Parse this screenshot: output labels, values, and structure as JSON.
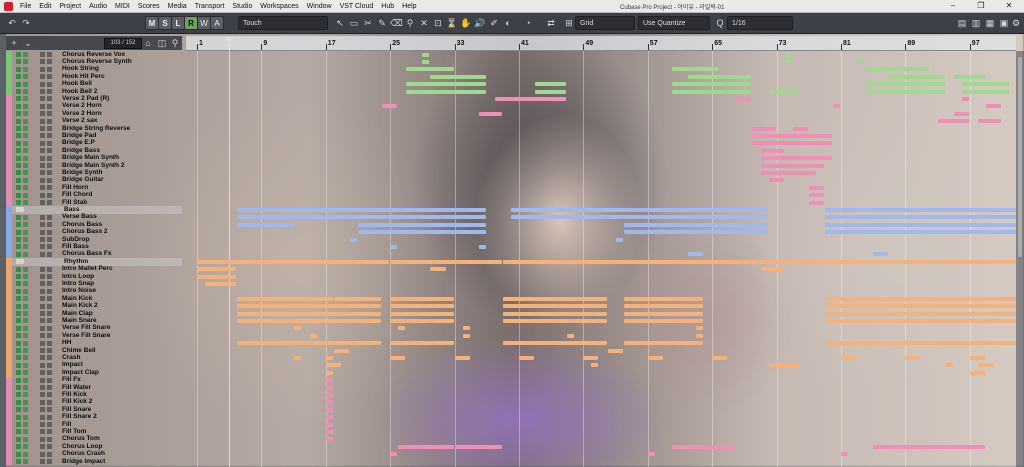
{
  "window": {
    "title": "Cubase Pro Project - 아이유 - 라일락-01"
  },
  "menubar": {
    "items": [
      "File",
      "Edit",
      "Project",
      "Audio",
      "MIDI",
      "Scores",
      "Media",
      "Transport",
      "Studio",
      "Workspaces",
      "Window",
      "VST Cloud",
      "Hub",
      "Help"
    ]
  },
  "toolbar": {
    "m": "M",
    "s": "S",
    "l": "L",
    "r": "R",
    "w": "W",
    "a": "A",
    "automation_mode": "Touch",
    "snap_type": "Grid",
    "quantize_mode": "Use Quantize",
    "quantize_value": "1/16"
  },
  "tracklist": {
    "counter": "103 / 152"
  },
  "ruler": {
    "bars": [
      "1",
      "9",
      "17",
      "25",
      "33",
      "41",
      "49",
      "57",
      "65",
      "73",
      "81",
      "89",
      "97"
    ]
  },
  "tracks": [
    {
      "name": "Chorus Reverse Vox",
      "color": "#7cc47a"
    },
    {
      "name": "Chorus Reverse Synth",
      "color": "#7cc47a"
    },
    {
      "name": "Hook String",
      "color": "#7cc47a"
    },
    {
      "name": "Hook Hit Perc",
      "color": "#7cc47a"
    },
    {
      "name": "Hook Bell",
      "color": "#7cc47a"
    },
    {
      "name": "Hook Bell 2",
      "color": "#7cc47a"
    },
    {
      "name": "Verse 2 Pad (R)",
      "color": "#e58ab0"
    },
    {
      "name": "Verse 2 Horn",
      "color": "#e58ab0"
    },
    {
      "name": "Verse 2 Horn",
      "color": "#e58ab0"
    },
    {
      "name": "Verse 2 sax",
      "color": "#e58ab0"
    },
    {
      "name": "Bridge String Reverse",
      "color": "#e58ab0"
    },
    {
      "name": "Bridge Pad",
      "color": "#e58ab0"
    },
    {
      "name": "Bridge E.P",
      "color": "#e58ab0"
    },
    {
      "name": "Bridge Bass",
      "color": "#e58ab0"
    },
    {
      "name": "Bridge Main Synth",
      "color": "#e58ab0"
    },
    {
      "name": "Bridge Main Synth 2",
      "color": "#e58ab0"
    },
    {
      "name": "Bridge Synth",
      "color": "#e58ab0"
    },
    {
      "name": "Bridge Guitar",
      "color": "#e58ab0"
    },
    {
      "name": "Fill Horn",
      "color": "#e58ab0"
    },
    {
      "name": "Fill Chord",
      "color": "#e58ab0"
    },
    {
      "name": "Fill Stab",
      "color": "#e58ab0"
    },
    {
      "name": "Bass",
      "color": "#8aa8e6",
      "folder": true
    },
    {
      "name": "Verse Bass",
      "color": "#8aa8e6"
    },
    {
      "name": "Chorus Bass",
      "color": "#8aa8e6"
    },
    {
      "name": "Chorus Bass 2",
      "color": "#8aa8e6"
    },
    {
      "name": "SubDrop",
      "color": "#8aa8e6"
    },
    {
      "name": "Fill Bass",
      "color": "#8aa8e6"
    },
    {
      "name": "Chorus Bass Fx",
      "color": "#8aa8e6"
    },
    {
      "name": "Rhythm",
      "color": "#f0a66a",
      "folder": true
    },
    {
      "name": "Intro Mallet Perc",
      "color": "#f0a66a"
    },
    {
      "name": "Intro Loop",
      "color": "#f0a66a"
    },
    {
      "name": "Intro Snap",
      "color": "#f0a66a"
    },
    {
      "name": "Intro Noise",
      "color": "#f0a66a"
    },
    {
      "name": "Main Kick",
      "color": "#f0a66a"
    },
    {
      "name": "Main Kick 2",
      "color": "#f0a66a"
    },
    {
      "name": "Main Clap",
      "color": "#f0a66a"
    },
    {
      "name": "Main Snare",
      "color": "#f0a66a"
    },
    {
      "name": "Verse Fill Snare",
      "color": "#f0a66a"
    },
    {
      "name": "Verse Fill Snare",
      "color": "#f0a66a"
    },
    {
      "name": "HH",
      "color": "#f0a66a"
    },
    {
      "name": "Chime Bell",
      "color": "#f0a66a"
    },
    {
      "name": "Crash",
      "color": "#f0a66a"
    },
    {
      "name": "Impact",
      "color": "#f0a66a"
    },
    {
      "name": "Impact Clap",
      "color": "#f0a66a"
    },
    {
      "name": "Fill Fx",
      "color": "#e58ab0"
    },
    {
      "name": "Fill Water",
      "color": "#e58ab0"
    },
    {
      "name": "Fill Kick",
      "color": "#e58ab0"
    },
    {
      "name": "Fill Kick 2",
      "color": "#e58ab0"
    },
    {
      "name": "Fill Snare",
      "color": "#e58ab0"
    },
    {
      "name": "Fill Snare 2",
      "color": "#e58ab0"
    },
    {
      "name": "Fill",
      "color": "#e58ab0"
    },
    {
      "name": "Fill Tom",
      "color": "#e58ab0"
    },
    {
      "name": "Chorus Tom",
      "color": "#e58ab0"
    },
    {
      "name": "Chorus Loop",
      "color": "#e58ab0"
    },
    {
      "name": "Chorus Crash",
      "color": "#e58ab0"
    },
    {
      "name": "Bridge Impact",
      "color": "#e58ab0"
    }
  ],
  "parts": [
    {
      "row": 0,
      "from": 29,
      "to": 30,
      "color": "#9fd98f"
    },
    {
      "row": 0,
      "from": 74,
      "to": 75,
      "color": "#9fd98f"
    },
    {
      "row": 1,
      "from": 29,
      "to": 30,
      "color": "#9fd98f"
    },
    {
      "row": 1,
      "from": 74,
      "to": 75,
      "color": "#9fd98f"
    },
    {
      "row": 1,
      "from": 83,
      "to": 84,
      "color": "#9fd98f"
    },
    {
      "row": 2,
      "from": 27,
      "to": 33,
      "color": "#9fd98f"
    },
    {
      "row": 2,
      "from": 60,
      "to": 66,
      "color": "#9fd98f"
    },
    {
      "row": 2,
      "from": 84,
      "to": 92,
      "color": "#9fd98f"
    },
    {
      "row": 3,
      "from": 30,
      "to": 37,
      "color": "#9fd98f"
    },
    {
      "row": 3,
      "from": 62,
      "to": 70,
      "color": "#9fd98f"
    },
    {
      "row": 3,
      "from": 87,
      "to": 94,
      "color": "#9fd98f"
    },
    {
      "row": 3,
      "from": 95,
      "to": 99,
      "color": "#9fd98f"
    },
    {
      "row": 4,
      "from": 27,
      "to": 37,
      "color": "#9fd98f"
    },
    {
      "row": 4,
      "from": 43,
      "to": 47,
      "color": "#9fd98f"
    },
    {
      "row": 4,
      "from": 60,
      "to": 70,
      "color": "#9fd98f"
    },
    {
      "row": 4,
      "from": 84,
      "to": 94,
      "color": "#9fd98f"
    },
    {
      "row": 4,
      "from": 96,
      "to": 102,
      "color": "#9fd98f"
    },
    {
      "row": 5,
      "from": 27,
      "to": 37,
      "color": "#9fd98f"
    },
    {
      "row": 5,
      "from": 43,
      "to": 47,
      "color": "#9fd98f"
    },
    {
      "row": 5,
      "from": 60,
      "to": 70,
      "color": "#9fd98f"
    },
    {
      "row": 5,
      "from": 72,
      "to": 76,
      "color": "#9fd98f"
    },
    {
      "row": 5,
      "from": 84,
      "to": 94,
      "color": "#9fd98f"
    },
    {
      "row": 5,
      "from": 96,
      "to": 102,
      "color": "#9fd98f"
    },
    {
      "row": 6,
      "from": 38,
      "to": 47,
      "color": "#ef8fb5"
    },
    {
      "row": 6,
      "from": 68,
      "to": 70,
      "color": "#ef8fb5"
    },
    {
      "row": 6,
      "from": 96,
      "to": 97,
      "color": "#ef8fb5"
    },
    {
      "row": 7,
      "from": 24,
      "to": 26,
      "color": "#ef8fb5"
    },
    {
      "row": 7,
      "from": 80,
      "to": 81,
      "color": "#ef8fb5"
    },
    {
      "row": 7,
      "from": 99,
      "to": 101,
      "color": "#ef8fb5"
    },
    {
      "row": 8,
      "from": 36,
      "to": 39,
      "color": "#ef8fb5"
    },
    {
      "row": 8,
      "from": 95,
      "to": 97,
      "color": "#ef8fb5"
    },
    {
      "row": 9,
      "from": 93,
      "to": 97,
      "color": "#ef8fb5"
    },
    {
      "row": 9,
      "from": 98,
      "to": 101,
      "color": "#ef8fb5"
    },
    {
      "row": 10,
      "from": 70,
      "to": 73,
      "color": "#ef8fb5"
    },
    {
      "row": 10,
      "from": 75,
      "to": 77,
      "color": "#ef8fb5"
    },
    {
      "row": 11,
      "from": 70,
      "to": 80,
      "color": "#ef8fb5"
    },
    {
      "row": 12,
      "from": 70,
      "to": 80,
      "color": "#ef8fb5"
    },
    {
      "row": 13,
      "from": 71,
      "to": 74,
      "color": "#ef8fb5"
    },
    {
      "row": 14,
      "from": 71,
      "to": 80,
      "color": "#ef8fb5"
    },
    {
      "row": 15,
      "from": 71,
      "to": 79,
      "color": "#ef8fb5"
    },
    {
      "row": 16,
      "from": 71,
      "to": 78,
      "color": "#ef8fb5"
    },
    {
      "row": 17,
      "from": 72,
      "to": 74,
      "color": "#ef8fb5"
    },
    {
      "row": 18,
      "from": 77,
      "to": 79,
      "color": "#ef8fb5"
    },
    {
      "row": 19,
      "from": 77,
      "to": 79,
      "color": "#ef8fb5"
    },
    {
      "row": 20,
      "from": 77,
      "to": 79,
      "color": "#ef8fb5"
    },
    {
      "row": 21,
      "from": 6,
      "to": 37,
      "color": "#9fb8ee"
    },
    {
      "row": 21,
      "from": 40,
      "to": 72,
      "color": "#9fb8ee"
    },
    {
      "row": 21,
      "from": 79,
      "to": 103,
      "color": "#9fb8ee"
    },
    {
      "row": 22,
      "from": 6,
      "to": 37,
      "color": "#9fb8ee"
    },
    {
      "row": 22,
      "from": 40,
      "to": 72,
      "color": "#9fb8ee"
    },
    {
      "row": 22,
      "from": 79,
      "to": 103,
      "color": "#9fb8ee"
    },
    {
      "row": 23,
      "from": 6,
      "to": 13,
      "color": "#9fb8ee"
    },
    {
      "row": 23,
      "from": 21,
      "to": 37,
      "color": "#9fb8ee"
    },
    {
      "row": 23,
      "from": 54,
      "to": 72,
      "color": "#9fb8ee"
    },
    {
      "row": 23,
      "from": 79,
      "to": 103,
      "color": "#9fb8ee"
    },
    {
      "row": 24,
      "from": 21,
      "to": 37,
      "color": "#9fb8ee"
    },
    {
      "row": 24,
      "from": 54,
      "to": 72,
      "color": "#9fb8ee"
    },
    {
      "row": 24,
      "from": 79,
      "to": 103,
      "color": "#9fb8ee"
    },
    {
      "row": 25,
      "from": 20,
      "to": 21,
      "color": "#9fb8ee"
    },
    {
      "row": 25,
      "from": 53,
      "to": 54,
      "color": "#9fb8ee"
    },
    {
      "row": 26,
      "from": 25,
      "to": 26,
      "color": "#9fb8ee"
    },
    {
      "row": 26,
      "from": 36,
      "to": 37,
      "color": "#9fb8ee"
    },
    {
      "row": 27,
      "from": 62,
      "to": 64,
      "color": "#9fb8ee"
    },
    {
      "row": 27,
      "from": 85,
      "to": 87,
      "color": "#9fb8ee"
    },
    {
      "row": 28,
      "from": 1,
      "to": 25,
      "color": "#f4b27a"
    },
    {
      "row": 28,
      "from": 25,
      "to": 39,
      "color": "#f4b27a"
    },
    {
      "row": 28,
      "from": 39,
      "to": 103,
      "color": "#f4b27a"
    },
    {
      "row": 29,
      "from": 1,
      "to": 6,
      "color": "#f4b27a"
    },
    {
      "row": 29,
      "from": 30,
      "to": 32,
      "color": "#f4b27a"
    },
    {
      "row": 29,
      "from": 71,
      "to": 74,
      "color": "#f4b27a"
    },
    {
      "row": 30,
      "from": 1,
      "to": 6,
      "color": "#f4b27a"
    },
    {
      "row": 31,
      "from": 2,
      "to": 6,
      "color": "#f4b27a"
    },
    {
      "row": 33,
      "from": 6,
      "to": 18,
      "color": "#f4b27a"
    },
    {
      "row": 33,
      "from": 18,
      "to": 24,
      "color": "#f4b27a"
    },
    {
      "row": 33,
      "from": 25,
      "to": 33,
      "color": "#f4b27a"
    },
    {
      "row": 33,
      "from": 39,
      "to": 52,
      "color": "#f4b27a"
    },
    {
      "row": 33,
      "from": 54,
      "to": 64,
      "color": "#f4b27a"
    },
    {
      "row": 33,
      "from": 79,
      "to": 103,
      "color": "#f4b27a"
    },
    {
      "row": 34,
      "from": 6,
      "to": 24,
      "color": "#f4b27a"
    },
    {
      "row": 34,
      "from": 25,
      "to": 33,
      "color": "#f4b27a"
    },
    {
      "row": 34,
      "from": 39,
      "to": 52,
      "color": "#f4b27a"
    },
    {
      "row": 34,
      "from": 54,
      "to": 64,
      "color": "#f4b27a"
    },
    {
      "row": 34,
      "from": 79,
      "to": 103,
      "color": "#f4b27a"
    },
    {
      "row": 35,
      "from": 6,
      "to": 24,
      "color": "#f4b27a"
    },
    {
      "row": 35,
      "from": 25,
      "to": 33,
      "color": "#f4b27a"
    },
    {
      "row": 35,
      "from": 39,
      "to": 52,
      "color": "#f4b27a"
    },
    {
      "row": 35,
      "from": 54,
      "to": 64,
      "color": "#f4b27a"
    },
    {
      "row": 35,
      "from": 79,
      "to": 103,
      "color": "#f4b27a"
    },
    {
      "row": 36,
      "from": 6,
      "to": 24,
      "color": "#f4b27a"
    },
    {
      "row": 36,
      "from": 25,
      "to": 33,
      "color": "#f4b27a"
    },
    {
      "row": 36,
      "from": 39,
      "to": 52,
      "color": "#f4b27a"
    },
    {
      "row": 36,
      "from": 54,
      "to": 64,
      "color": "#f4b27a"
    },
    {
      "row": 36,
      "from": 79,
      "to": 103,
      "color": "#f4b27a"
    },
    {
      "row": 37,
      "from": 13,
      "to": 14,
      "color": "#f4b27a"
    },
    {
      "row": 37,
      "from": 26,
      "to": 27,
      "color": "#f4b27a"
    },
    {
      "row": 37,
      "from": 34,
      "to": 35,
      "color": "#f4b27a"
    },
    {
      "row": 37,
      "from": 63,
      "to": 64,
      "color": "#f4b27a"
    },
    {
      "row": 38,
      "from": 15,
      "to": 16,
      "color": "#f4b27a"
    },
    {
      "row": 38,
      "from": 34,
      "to": 35,
      "color": "#f4b27a"
    },
    {
      "row": 38,
      "from": 47,
      "to": 48,
      "color": "#f4b27a"
    },
    {
      "row": 38,
      "from": 63,
      "to": 64,
      "color": "#f4b27a"
    },
    {
      "row": 39,
      "from": 6,
      "to": 24,
      "color": "#f4b27a"
    },
    {
      "row": 39,
      "from": 25,
      "to": 33,
      "color": "#f4b27a"
    },
    {
      "row": 39,
      "from": 39,
      "to": 52,
      "color": "#f4b27a"
    },
    {
      "row": 39,
      "from": 54,
      "to": 64,
      "color": "#f4b27a"
    },
    {
      "row": 39,
      "from": 79,
      "to": 103,
      "color": "#f4b27a"
    },
    {
      "row": 40,
      "from": 18,
      "to": 20,
      "color": "#f4b27a"
    },
    {
      "row": 40,
      "from": 52,
      "to": 54,
      "color": "#f4b27a"
    },
    {
      "row": 41,
      "from": 13,
      "to": 14,
      "color": "#f4b27a"
    },
    {
      "row": 41,
      "from": 17,
      "to": 18,
      "color": "#f4b27a"
    },
    {
      "row": 41,
      "from": 25,
      "to": 27,
      "color": "#f4b27a"
    },
    {
      "row": 41,
      "from": 33,
      "to": 35,
      "color": "#f4b27a"
    },
    {
      "row": 41,
      "from": 41,
      "to": 43,
      "color": "#f4b27a"
    },
    {
      "row": 41,
      "from": 49,
      "to": 51,
      "color": "#f4b27a"
    },
    {
      "row": 41,
      "from": 57,
      "to": 59,
      "color": "#f4b27a"
    },
    {
      "row": 41,
      "from": 65,
      "to": 67,
      "color": "#f4b27a"
    },
    {
      "row": 41,
      "from": 81,
      "to": 83,
      "color": "#f4b27a"
    },
    {
      "row": 41,
      "from": 89,
      "to": 91,
      "color": "#f4b27a"
    },
    {
      "row": 41,
      "from": 97,
      "to": 99,
      "color": "#f4b27a"
    },
    {
      "row": 42,
      "from": 17,
      "to": 19,
      "color": "#f4b27a"
    },
    {
      "row": 42,
      "from": 50,
      "to": 51,
      "color": "#f4b27a"
    },
    {
      "row": 42,
      "from": 72,
      "to": 76,
      "color": "#f4b27a"
    },
    {
      "row": 42,
      "from": 94,
      "to": 95,
      "color": "#f4b27a"
    },
    {
      "row": 42,
      "from": 98,
      "to": 100,
      "color": "#f4b27a"
    },
    {
      "row": 43,
      "from": 17,
      "to": 18,
      "color": "#f4b27a"
    },
    {
      "row": 43,
      "from": 97,
      "to": 99,
      "color": "#f4b27a"
    },
    {
      "row": 44,
      "from": 17,
      "to": 18,
      "color": "#ef8fb5"
    },
    {
      "row": 45,
      "from": 17,
      "to": 18,
      "color": "#ef8fb5"
    },
    {
      "row": 46,
      "from": 17,
      "to": 18,
      "color": "#ef8fb5"
    },
    {
      "row": 47,
      "from": 17,
      "to": 18,
      "color": "#ef8fb5"
    },
    {
      "row": 48,
      "from": 17,
      "to": 18,
      "color": "#ef8fb5"
    },
    {
      "row": 49,
      "from": 17,
      "to": 18,
      "color": "#ef8fb5"
    },
    {
      "row": 50,
      "from": 17,
      "to": 18,
      "color": "#ef8fb5"
    },
    {
      "row": 51,
      "from": 17,
      "to": 18,
      "color": "#ef8fb5"
    },
    {
      "row": 52,
      "from": 17,
      "to": 18,
      "color": "#ef8fb5"
    },
    {
      "row": 53,
      "from": 26,
      "to": 33,
      "color": "#ef8fb5"
    },
    {
      "row": 53,
      "from": 33,
      "to": 39,
      "color": "#ef8fb5"
    },
    {
      "row": 53,
      "from": 60,
      "to": 68,
      "color": "#ef8fb5"
    },
    {
      "row": 53,
      "from": 85,
      "to": 99,
      "color": "#ef8fb5"
    },
    {
      "row": 54,
      "from": 25,
      "to": 26,
      "color": "#ef8fb5"
    },
    {
      "row": 54,
      "from": 57,
      "to": 58,
      "color": "#ef8fb5"
    },
    {
      "row": 54,
      "from": 81,
      "to": 82,
      "color": "#ef8fb5"
    }
  ]
}
